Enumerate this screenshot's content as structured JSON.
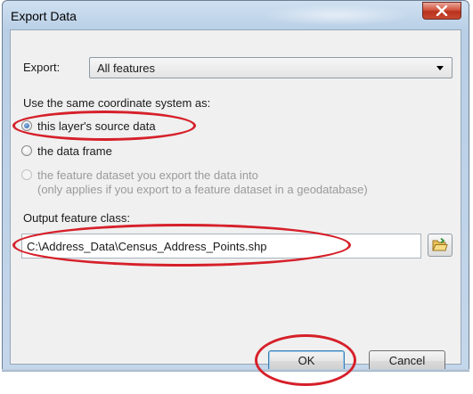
{
  "window": {
    "title": "Export Data"
  },
  "export": {
    "label": "Export:",
    "selected": "All features"
  },
  "coordinate": {
    "heading": "Use the same coordinate system as:",
    "options": [
      {
        "label": "this layer's source data",
        "checked": true,
        "enabled": true
      },
      {
        "label": "the data frame",
        "checked": false,
        "enabled": true
      },
      {
        "label": "the feature dataset you export the data into",
        "sublabel": "(only applies if you export to a feature dataset in a geodatabase)",
        "checked": false,
        "enabled": false
      }
    ]
  },
  "output": {
    "label": "Output feature class:",
    "value": "C:\\Address_Data\\Census_Address_Points.shp"
  },
  "buttons": {
    "ok": "OK",
    "cancel": "Cancel"
  },
  "colors": {
    "annotation": "#d6202a",
    "title_bar": "#c4d6ea",
    "close_button": "#c8482f"
  },
  "icons": {
    "close": "close-icon",
    "browse": "folder-open-icon",
    "dropdown": "chevron-down-icon"
  }
}
